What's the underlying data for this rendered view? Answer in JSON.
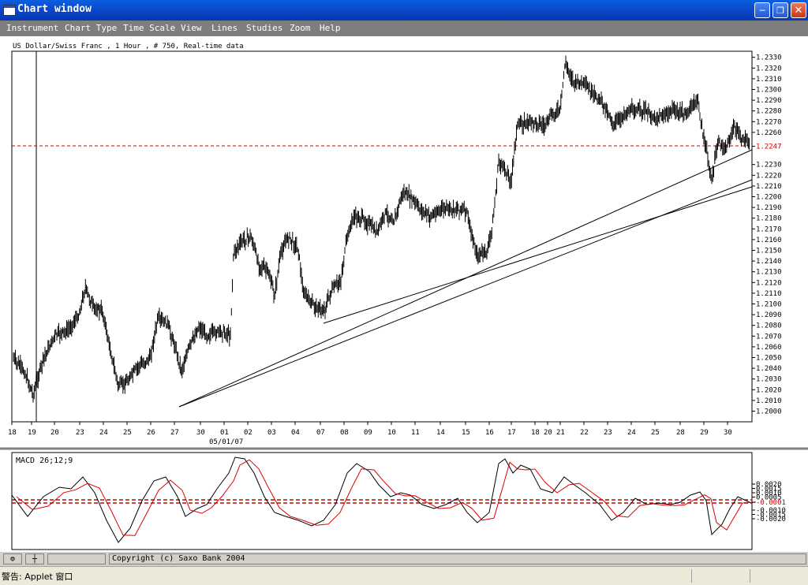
{
  "window": {
    "title": "Chart window"
  },
  "menu": [
    "Instrument",
    "Chart Type",
    "Time Scale",
    "View",
    "Lines",
    "Studies",
    "Zoom",
    "Help"
  ],
  "chart": {
    "header": "US Dollar/Swiss Franc , 1 Hour , # 750, Real-time data",
    "price_ticks": [
      "1.2330",
      "1.2320",
      "1.2310",
      "1.2300",
      "1.2290",
      "1.2280",
      "1.2270",
      "1.2260",
      "1.2247",
      "1.2230",
      "1.2220",
      "1.2210",
      "1.2200",
      "1.2190",
      "1.2180",
      "1.2170",
      "1.2160",
      "1.2150",
      "1.2140",
      "1.2130",
      "1.2120",
      "1.2110",
      "1.2100",
      "1.2090",
      "1.2080",
      "1.2070",
      "1.2060",
      "1.2050",
      "1.2040",
      "1.2030",
      "1.2020",
      "1.2010",
      "1.2000"
    ],
    "current_price": "1.2247",
    "date_ticks": [
      "18",
      "19",
      "20",
      "23",
      "24",
      "25",
      "26",
      "27",
      "30",
      "01",
      "02",
      "03",
      "04",
      "07",
      "08",
      "09",
      "10",
      "11",
      "14",
      "15",
      "16",
      "17",
      "18",
      "20",
      "21",
      "22",
      "23",
      "24",
      "25",
      "28",
      "29",
      "30"
    ],
    "month_label": "05/01/07"
  },
  "macd": {
    "label": "MACD 26;12;9",
    "ticks": [
      "0.0020",
      "0.0015",
      "0.0010",
      "0.0005",
      "-0.0001",
      "-0.0010",
      "-0.0015",
      "-0.0020"
    ],
    "current_value": "-0.0001"
  },
  "colors": {
    "titlebar": "#0a47c8",
    "menubar": "#7e7e7e",
    "price_line": "#cc0000",
    "signal_line": "#dd0000"
  },
  "bottombar": {
    "copyright": "Copyright (c) Saxo Bank 2004"
  },
  "status": {
    "text": "警告: Applet 窗口"
  }
}
